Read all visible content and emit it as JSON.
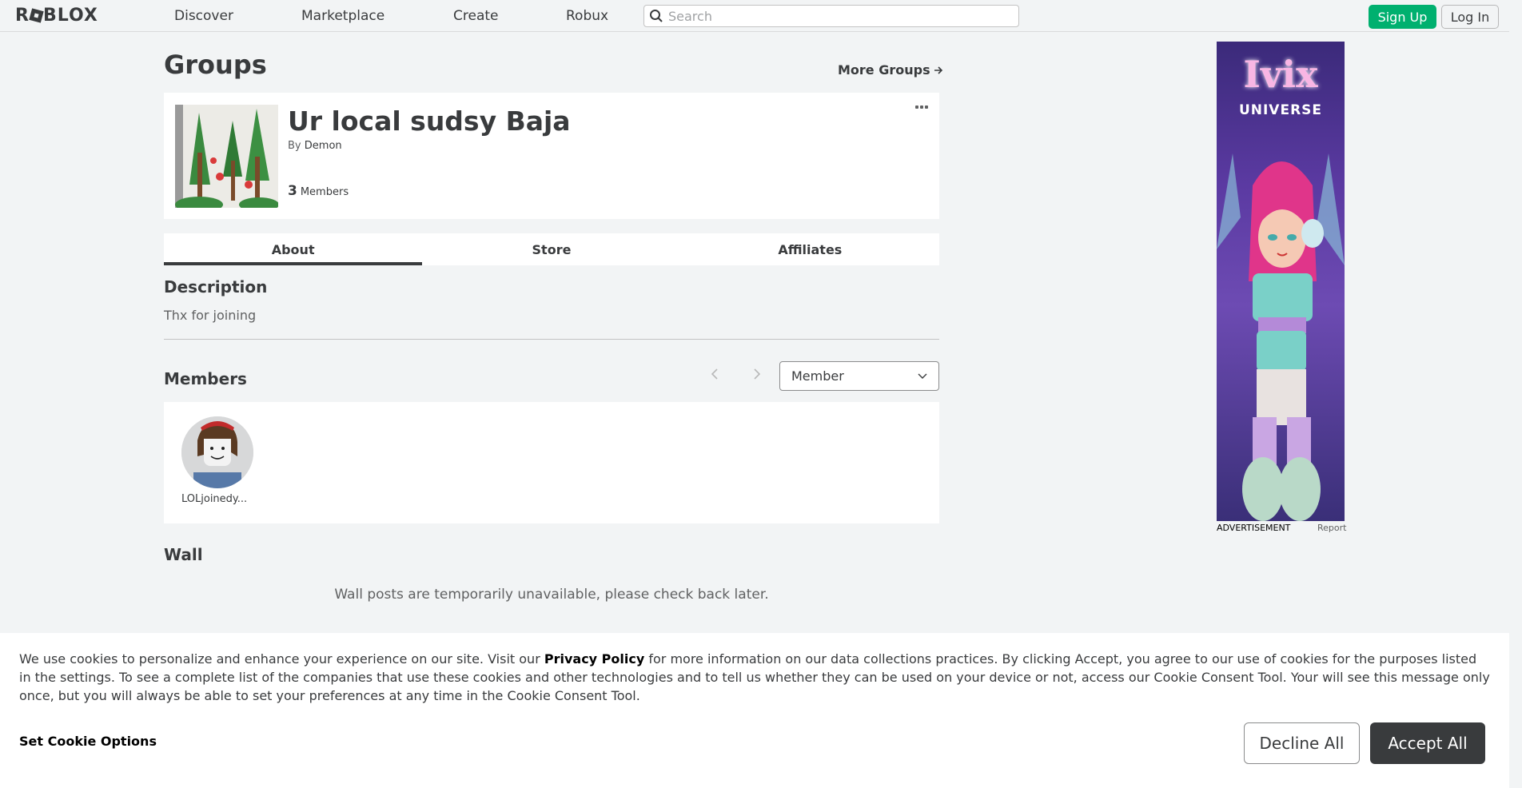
{
  "topbar": {
    "logo_text": "RBLOX",
    "nav": [
      "Discover",
      "Marketplace",
      "Create",
      "Robux"
    ],
    "search_placeholder": "Search",
    "signup_label": "Sign Up",
    "login_label": "Log In"
  },
  "page": {
    "title": "Groups",
    "more_groups": "More Groups",
    "more_groups_icon": "arrow-right-icon"
  },
  "group": {
    "name": "Ur local sudsy Baja",
    "owner_prefix": "By",
    "owner": "Demon",
    "member_count": "3",
    "members_label": "Members"
  },
  "tabs": [
    "About",
    "Store",
    "Affiliates"
  ],
  "about": {
    "description_heading": "Description",
    "description_text": "Thx for joining",
    "members_heading": "Members",
    "role_select": "Member",
    "members": [
      {
        "name": "LOLjoinedy..."
      }
    ],
    "wall_heading": "Wall",
    "wall_message": "Wall posts are temporarily unavailable, please check back later."
  },
  "ad": {
    "title": "Ivix",
    "subtitle": "UNIVERSE",
    "label": "ADVERTISEMENT",
    "report": "Report"
  },
  "cookie": {
    "text_before": "We use cookies to personalize and enhance your experience on our site. Visit our ",
    "privacy_link": "Privacy Policy",
    "text_after": " for more information on our data collections practices. By clicking Accept, you agree to our use of cookies for the purposes listed in the settings. To see a complete list of the companies that use these cookies and other technologies and to tell us whether they can be used on your device or not, access our Cookie Consent Tool. Your will see this message only once, but you will always be able to set your preferences at any time in the Cookie Consent Tool.",
    "set_options": "Set Cookie Options",
    "decline": "Decline All",
    "accept": "Accept All"
  },
  "colors": {
    "brand_green": "#00b06f",
    "text_dark": "#393b3d",
    "page_bg": "#f2f4f5"
  }
}
